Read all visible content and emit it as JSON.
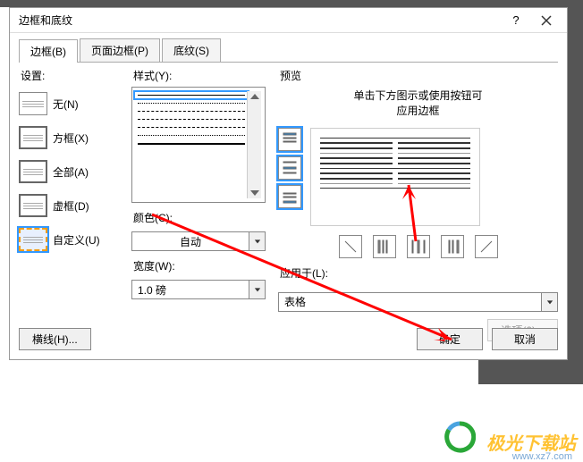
{
  "titlebar": {
    "title": "边框和底纹"
  },
  "tabs": {
    "border": "边框(B)",
    "page_border": "页面边框(P)",
    "shading": "底纹(S)"
  },
  "settings": {
    "label": "设置:",
    "none": "无(N)",
    "box": "方框(X)",
    "all": "全部(A)",
    "grid": "虚框(D)",
    "custom": "自定义(U)"
  },
  "style": {
    "label": "样式(Y):",
    "color_label": "颜色(C):",
    "color_value": "自动",
    "width_label": "宽度(W):",
    "width_value": "1.0 磅"
  },
  "preview": {
    "label": "预览",
    "hint_line1": "单击下方图示或使用按钮可",
    "hint_line2": "应用边框",
    "apply_label": "应用于(L):",
    "apply_value": "表格",
    "options": "选项(0)..."
  },
  "footer": {
    "hline": "横线(H)...",
    "ok": "确定",
    "cancel": "取消"
  },
  "watermark": {
    "brand": "极光下载站",
    "url": "www.xz7.com"
  }
}
